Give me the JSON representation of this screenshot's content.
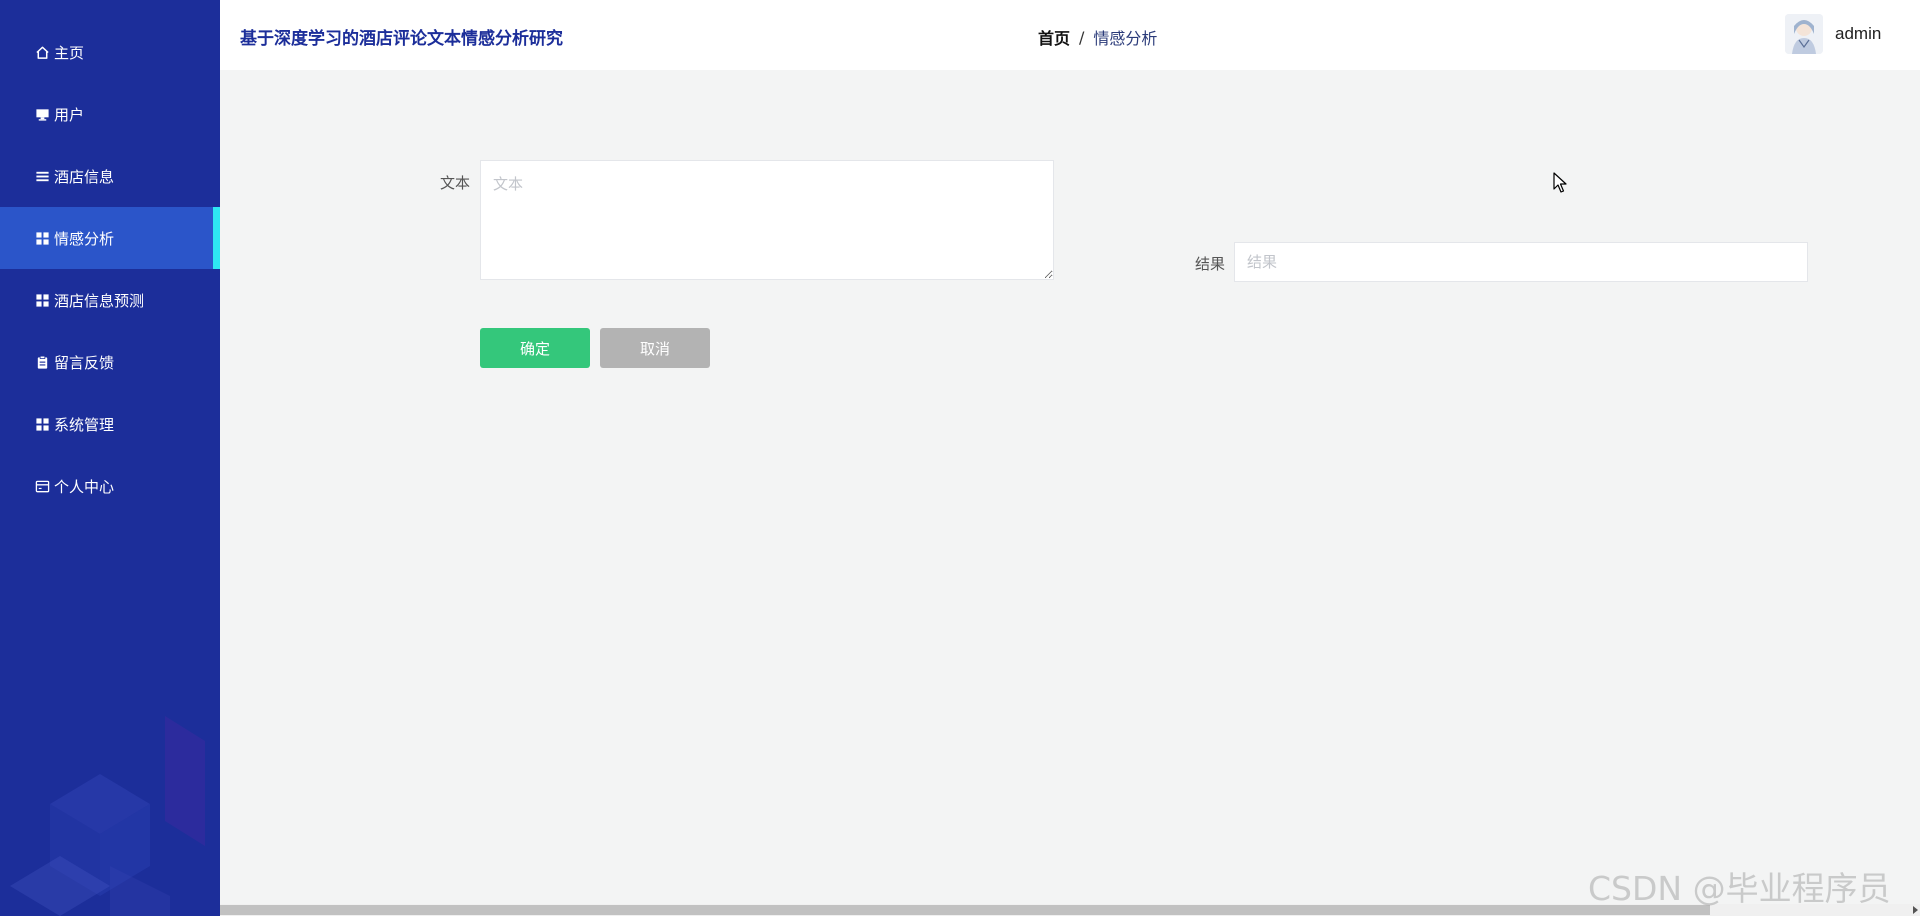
{
  "sidebar": {
    "items": [
      {
        "label": "主页",
        "icon": "home-icon"
      },
      {
        "label": "用户",
        "icon": "monitor-icon"
      },
      {
        "label": "酒店信息",
        "icon": "list-icon"
      },
      {
        "label": "情感分析",
        "icon": "grid-icon",
        "active": true
      },
      {
        "label": "酒店信息预测",
        "icon": "grid-icon"
      },
      {
        "label": "留言反馈",
        "icon": "clipboard-icon"
      },
      {
        "label": "系统管理",
        "icon": "grid-icon"
      },
      {
        "label": "个人中心",
        "icon": "card-icon"
      }
    ]
  },
  "header": {
    "title": "基于深度学习的酒店评论文本情感分析研究",
    "breadcrumb_home": "首页",
    "breadcrumb_sep": "/",
    "breadcrumb_current": "情感分析",
    "username": "admin"
  },
  "form": {
    "text_label": "文本",
    "text_placeholder": "文本",
    "text_value": "",
    "result_label": "结果",
    "result_placeholder": "结果",
    "result_value": "",
    "confirm_label": "确定",
    "cancel_label": "取消"
  },
  "watermark": "CSDN @毕业程序员",
  "colors": {
    "sidebar_bg": "#1c2e9a",
    "sidebar_active": "#2b55c9",
    "active_indicator": "#2ee8f3",
    "confirm": "#34c77b",
    "cancel": "#b3b3b3"
  }
}
